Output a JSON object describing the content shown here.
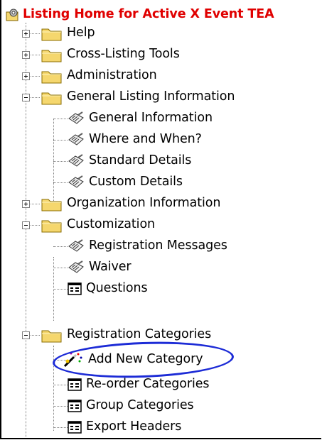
{
  "tree": {
    "root": {
      "label": "Listing Home for Active X Event TEA",
      "icon": "gear-folder-icon"
    },
    "items": [
      {
        "label": "Help",
        "icon": "folder-icon",
        "expander": "plus"
      },
      {
        "label": "Cross-Listing Tools",
        "icon": "folder-icon",
        "expander": "plus"
      },
      {
        "label": "Administration",
        "icon": "folder-icon",
        "expander": "plus"
      },
      {
        "label": "General Listing Information",
        "icon": "folder-icon",
        "expander": "minus",
        "children": [
          {
            "label": "General Information",
            "icon": "form-icon"
          },
          {
            "label": "Where and When?",
            "icon": "form-icon"
          },
          {
            "label": "Standard Details",
            "icon": "form-icon"
          },
          {
            "label": "Custom Details",
            "icon": "form-icon"
          }
        ]
      },
      {
        "label": "Organization Information",
        "icon": "folder-icon",
        "expander": "plus"
      },
      {
        "label": "Customization",
        "icon": "folder-icon",
        "expander": "minus",
        "children": [
          {
            "label": "Registration Messages",
            "icon": "form-icon"
          },
          {
            "label": "Waiver",
            "icon": "form-icon"
          },
          {
            "label": "Questions",
            "icon": "grid-icon"
          }
        ]
      },
      {
        "label": "Registration Categories",
        "icon": "folder-icon",
        "expander": "minus",
        "children": [
          {
            "label": "Add New Category",
            "icon": "wand-icon",
            "highlighted": true
          },
          {
            "label": "Re-order Categories",
            "icon": "grid-icon"
          },
          {
            "label": "Group Categories",
            "icon": "grid-icon"
          },
          {
            "label": "Export Headers",
            "icon": "grid-icon"
          }
        ]
      }
    ]
  },
  "colors": {
    "root_text": "#e00000",
    "highlight_ellipse": "#1c2bd6",
    "folder": "#f5d76e"
  }
}
